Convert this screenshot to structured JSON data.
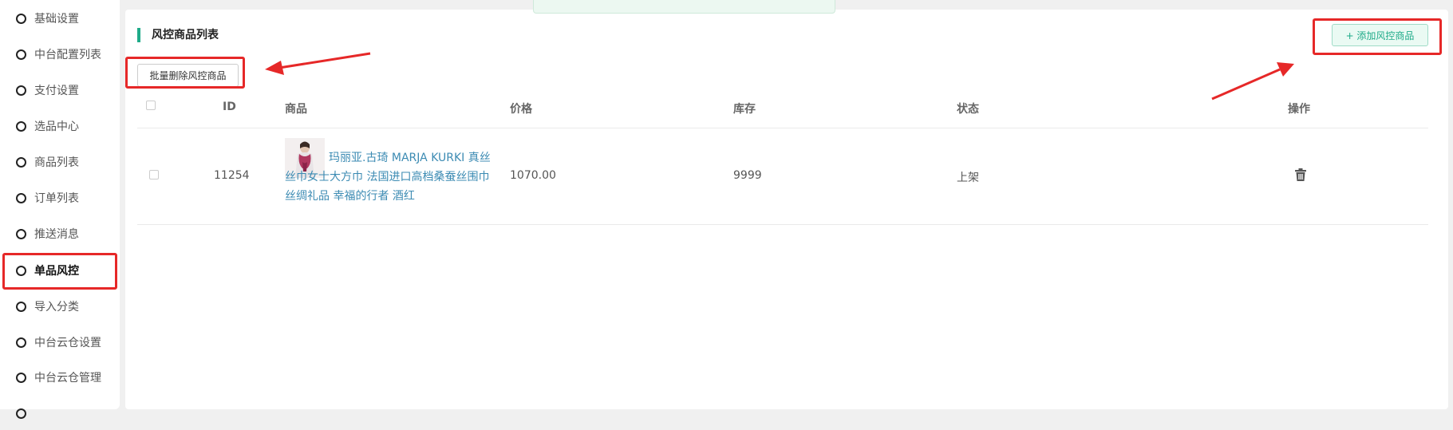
{
  "sidebar": {
    "items": [
      {
        "label": "基础设置"
      },
      {
        "label": "中台配置列表"
      },
      {
        "label": "支付设置"
      },
      {
        "label": "选品中心"
      },
      {
        "label": "商品列表"
      },
      {
        "label": "订单列表"
      },
      {
        "label": "推送消息"
      },
      {
        "label": "单品风控",
        "active": true
      },
      {
        "label": "导入分类"
      },
      {
        "label": "中台云仓设置"
      },
      {
        "label": "中台云仓管理"
      }
    ]
  },
  "page": {
    "title": "风控商品列表",
    "add_button": "+ 添加风控商品",
    "batch_delete_button": "批量删除风控商品"
  },
  "table": {
    "headers": {
      "id": "ID",
      "product": "商品",
      "price": "价格",
      "stock": "库存",
      "status": "状态",
      "action": "操作"
    },
    "rows": [
      {
        "id": "11254",
        "product": "玛丽亚.古琦 MARJA KURKI 真丝丝巾女士大方巾 法国进口高档桑蚕丝围巾丝绸礼品 幸福的行者 酒红",
        "price": "1070.00",
        "stock": "9999",
        "status": "上架",
        "action_icon": "trash-icon"
      }
    ]
  },
  "colors": {
    "accent": "#1fab89",
    "link": "#3c8bb3",
    "annotation": "#e62828"
  }
}
